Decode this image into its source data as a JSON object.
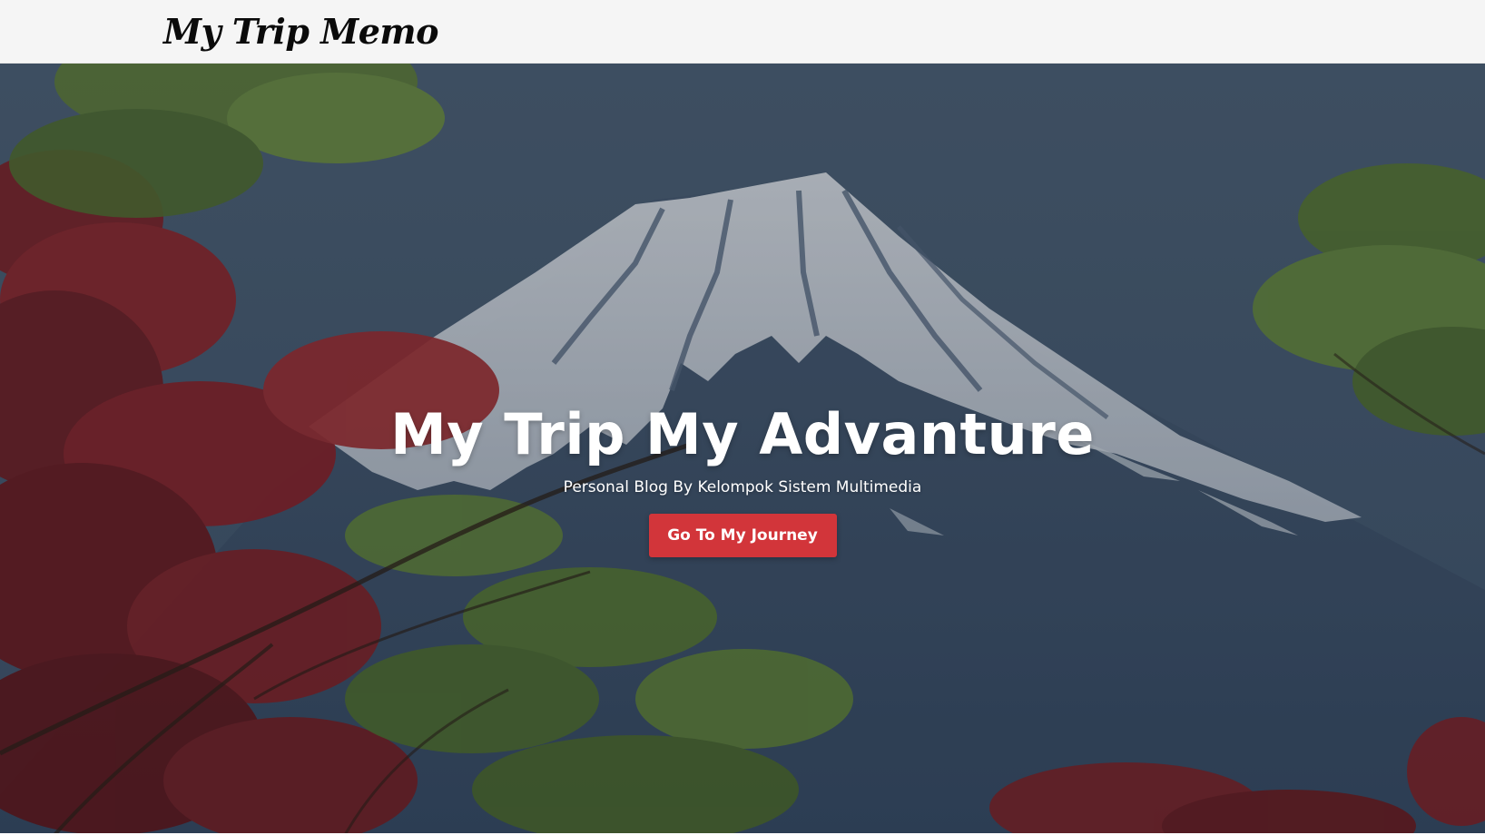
{
  "navbar": {
    "brand": "My Trip Memo"
  },
  "hero": {
    "title": "My Trip My Advanture",
    "subtitle": "Personal Blog By Kelompok Sistem Multimedia",
    "cta_label": "Go To My Journey",
    "background_image": "mount-fuji-with-maple-and-green-leaves"
  },
  "colors": {
    "navbar_bg": "#f5f5f5",
    "sky": "#465a6f",
    "mountain_snow": "#d7dbe0",
    "cta_button": "#d2353a",
    "text_light": "#ffffff",
    "brand_text": "#0a0a0a"
  }
}
